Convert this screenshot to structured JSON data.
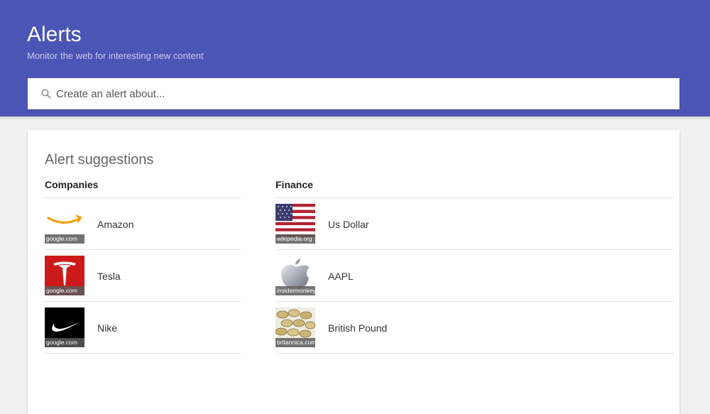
{
  "header": {
    "title": "Alerts",
    "subtitle": "Monitor the web for interesting new content",
    "background_color": "#4a55b5"
  },
  "search": {
    "placeholder": "Create an alert about...",
    "value": "",
    "icon": "search-icon"
  },
  "suggestions": {
    "title": "Alert suggestions",
    "companies": {
      "heading": "Companies",
      "items": [
        {
          "label": "Amazon",
          "source": "google.com",
          "thumbnail": "amazon-logo"
        },
        {
          "label": "Tesla",
          "source": "google.com",
          "thumbnail": "tesla-logo"
        },
        {
          "label": "Nike",
          "source": "google.com",
          "thumbnail": "nike-logo"
        }
      ]
    },
    "finance": {
      "heading": "Finance",
      "items": [
        {
          "label": "Us Dollar",
          "source": "wikipedia.org",
          "thumbnail": "us-flag"
        },
        {
          "label": "AAPL",
          "source": "insidermonkey",
          "thumbnail": "apple-logo"
        },
        {
          "label": "British Pound",
          "source": "britannica.com",
          "thumbnail": "pound-coins"
        }
      ]
    }
  }
}
